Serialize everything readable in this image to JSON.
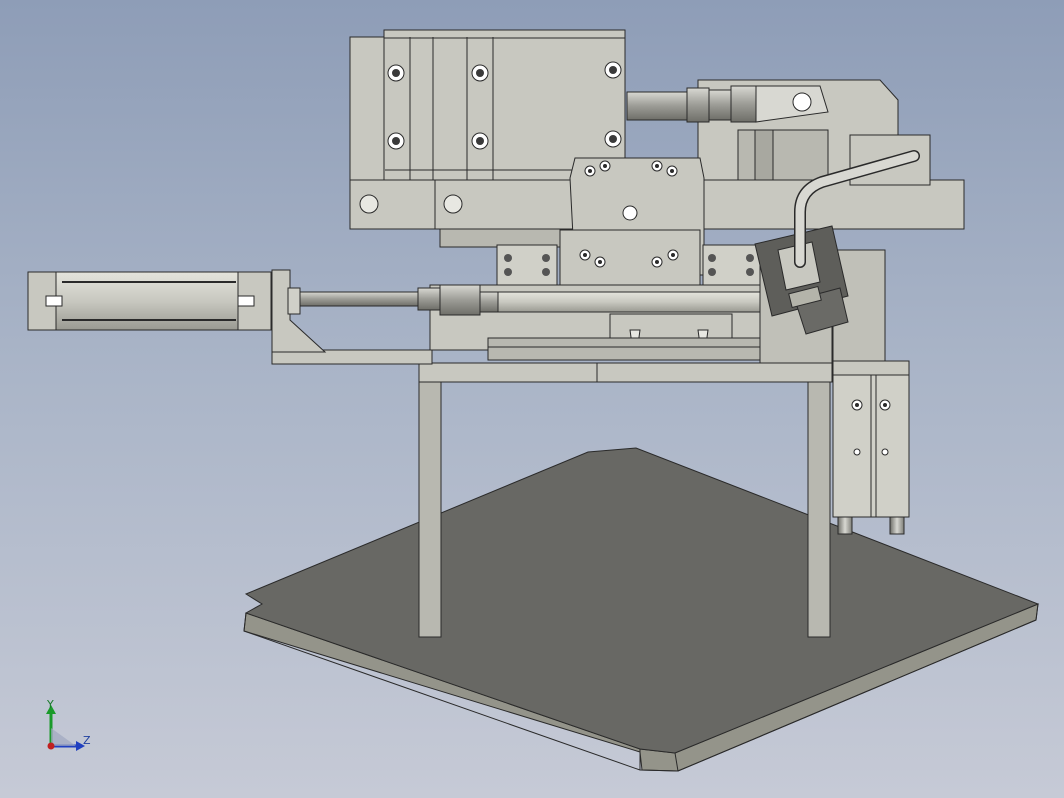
{
  "viewport": {
    "background_top": "#8e9db7",
    "background_bottom": "#c6cad6",
    "part_fill": "#c8c8c0",
    "part_fill_dark": "#b4b4aa",
    "edge_color": "#2a2a2a",
    "plate_color": "#686864"
  },
  "triad": {
    "y_label": "Y",
    "z_label": "Z",
    "y_color": "#1a9a2a",
    "z_color": "#2040c0",
    "x_color": "#c02020"
  }
}
